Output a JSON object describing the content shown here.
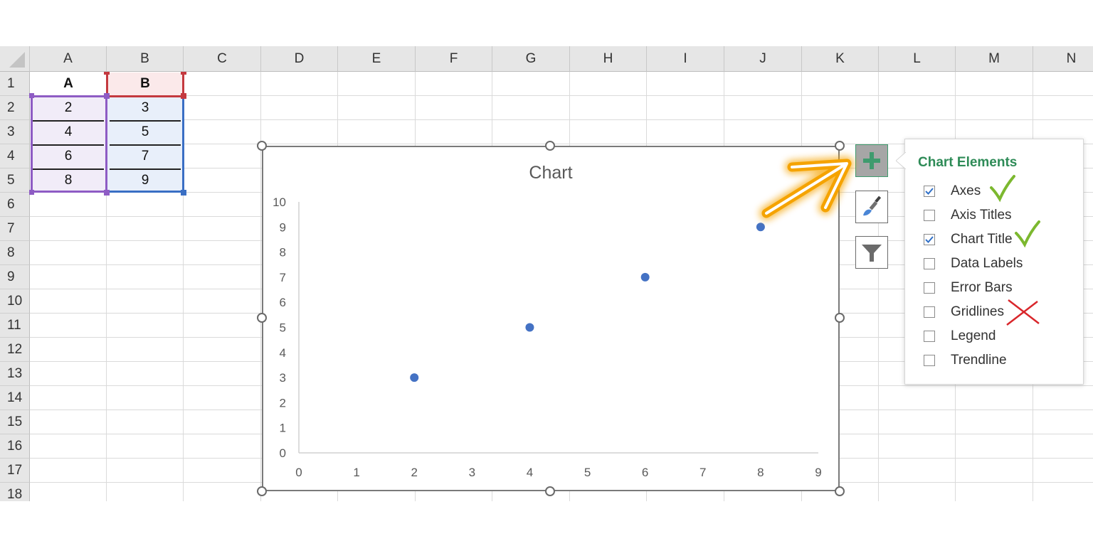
{
  "spreadsheet": {
    "columns": [
      "A",
      "B",
      "C",
      "D",
      "E",
      "F",
      "G",
      "H",
      "I",
      "J",
      "K",
      "L",
      "M",
      "N"
    ],
    "rows": [
      "1",
      "2",
      "3",
      "4",
      "5",
      "6",
      "7",
      "8",
      "9",
      "10",
      "11",
      "12",
      "13",
      "14",
      "15",
      "16",
      "17",
      "18"
    ],
    "cells": {
      "A1": "A",
      "B1": "B",
      "A2": "2",
      "B2": "3",
      "A3": "4",
      "B3": "5",
      "A4": "6",
      "B4": "7",
      "A5": "8",
      "B5": "9"
    },
    "highlight_colors": {
      "x_range": "#8e5cc4",
      "series_name": "#c4393f",
      "y_range": "#3a6fc4"
    }
  },
  "chart_data": {
    "type": "scatter",
    "title": "Chart",
    "xlabel": "",
    "ylabel": "",
    "x": [
      2,
      4,
      6,
      8
    ],
    "series": [
      {
        "name": "B",
        "values": [
          3,
          5,
          7,
          9
        ],
        "color": "#4472c4"
      }
    ],
    "xlim": [
      0,
      9
    ],
    "ylim": [
      0,
      10
    ],
    "xticks": [
      "0",
      "1",
      "2",
      "3",
      "4",
      "5",
      "6",
      "7",
      "8",
      "9"
    ],
    "yticks": [
      "0",
      "1",
      "2",
      "3",
      "4",
      "5",
      "6",
      "7",
      "8",
      "9",
      "10"
    ],
    "grid": false,
    "legend": "none"
  },
  "chart_buttons": {
    "add": "plus-icon",
    "styles": "paintbrush-icon",
    "filters": "filter-icon"
  },
  "chart_elements_panel": {
    "title": "Chart Elements",
    "title_color": "#2e8b57",
    "items": [
      {
        "label": "Axes",
        "checked": true,
        "annotation": "check"
      },
      {
        "label": "Axis Titles",
        "checked": false,
        "annotation": ""
      },
      {
        "label": "Chart Title",
        "checked": true,
        "annotation": "check"
      },
      {
        "label": "Data Labels",
        "checked": false,
        "annotation": ""
      },
      {
        "label": "Error Bars",
        "checked": false,
        "annotation": ""
      },
      {
        "label": "Gridlines",
        "checked": false,
        "annotation": "cross"
      },
      {
        "label": "Legend",
        "checked": false,
        "annotation": ""
      },
      {
        "label": "Trendline",
        "checked": false,
        "annotation": ""
      }
    ]
  },
  "annotations": {
    "arrow_color": "#f5a300",
    "check_color": "#7cb82f",
    "cross_color": "#d9262b"
  }
}
